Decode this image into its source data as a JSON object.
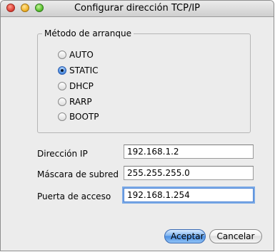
{
  "window": {
    "title": "Configurar dirección TCP/IP"
  },
  "boot_method": {
    "label": "Método de arranque",
    "options": [
      {
        "label": "AUTO",
        "selected": false
      },
      {
        "label": "STATIC",
        "selected": true
      },
      {
        "label": "DHCP",
        "selected": false
      },
      {
        "label": "RARP",
        "selected": false
      },
      {
        "label": "BOOTP",
        "selected": false
      }
    ]
  },
  "fields": {
    "ip": {
      "label": "Dirección IP",
      "value": "192.168.1.2"
    },
    "subnet": {
      "label": "Máscara de subred",
      "value": "255.255.255.0"
    },
    "gateway": {
      "label": "Puerta de acceso",
      "value": "192.168.1.254"
    }
  },
  "buttons": {
    "ok": "Aceptar",
    "cancel": "Cancelar"
  },
  "colors": {
    "accent": "#4c8fe3",
    "window_bg": "#ececec"
  }
}
